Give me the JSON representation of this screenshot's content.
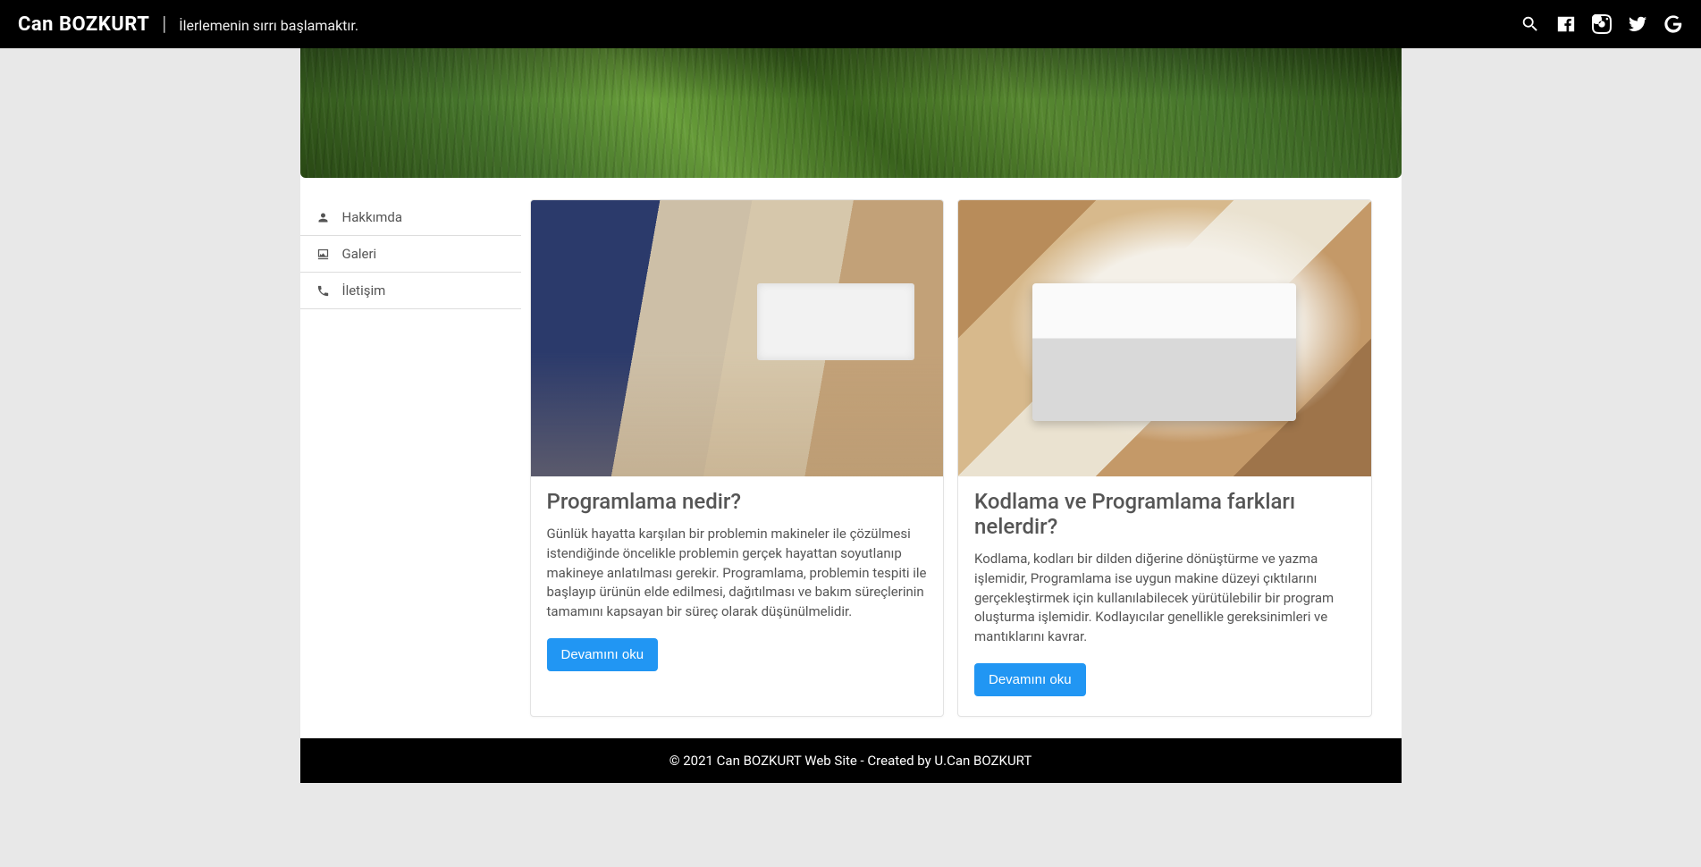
{
  "header": {
    "site_title": "Can BOZKURT",
    "divider": "|",
    "tagline": "İlerlemenin sırrı başlamaktır."
  },
  "sidebar": {
    "items": [
      {
        "label": "Hakkımda"
      },
      {
        "label": "Galeri"
      },
      {
        "label": "İletişim"
      }
    ]
  },
  "cards": [
    {
      "title": "Programlama nedir?",
      "text": "Günlük hayatta karşılan bir problemin makineler ile çözülmesi istendiğinde öncelikle problemin gerçek hayattan soyutlanıp makineye anlatılması gerekir. Programlama, problemin tespiti ile başlayıp ürünün elde edilmesi, dağıtılması ve bakım süreçlerinin tamamını kapsayan bir süreç olarak düşünülmelidir.",
      "button": "Devamını oku"
    },
    {
      "title": "Kodlama ve Programlama farkları nelerdir?",
      "text": "Kodlama, kodları bir dilden diğerine dönüştürme ve yazma işlemidir, Programlama ise uygun makine düzeyi çıktılarını gerçekleştirmek için kullanılabilecek yürütülebilir bir program oluşturma işlemidir. Kodlayıcılar genellikle gereksinimleri ve mantıklarını kavrar.",
      "button": "Devamını oku"
    }
  ],
  "footer": {
    "text": "© 2021 Can BOZKURT Web Site - Created by U.Can BOZKURT"
  }
}
